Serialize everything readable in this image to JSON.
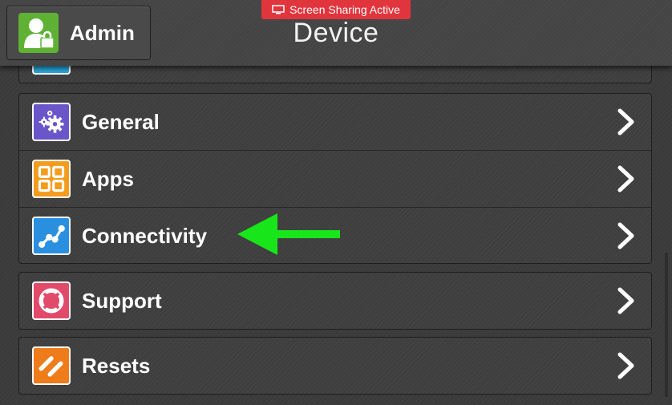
{
  "header": {
    "title": "Device",
    "share_badge": "Screen Sharing Active",
    "admin_label": "Admin"
  },
  "menu": {
    "items": [
      {
        "label": "General",
        "icon": "gears-icon",
        "color": "#6a55c9"
      },
      {
        "label": "Apps",
        "icon": "apps-grid-icon",
        "color": "#f39c1e"
      },
      {
        "label": "Connectivity",
        "icon": "connectivity-icon",
        "color": "#2b8fe0"
      },
      {
        "label": "Support",
        "icon": "lifebuoy-icon",
        "color": "#e24a6a"
      },
      {
        "label": "Resets",
        "icon": "resets-icon",
        "color": "#ee7c1a"
      }
    ]
  },
  "colors": {
    "share_badge": "#e0353d",
    "admin_avatar": "#5fb134",
    "highlight_arrow": "#19e61a",
    "partial_row_icon": "#2aa5d8"
  }
}
